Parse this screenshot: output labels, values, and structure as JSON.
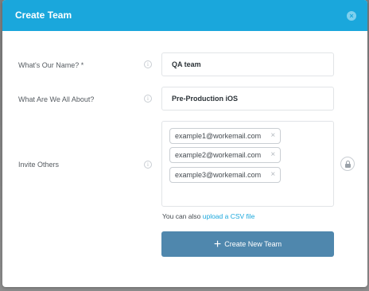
{
  "modal": {
    "title": "Create Team",
    "close_icon": "×"
  },
  "form": {
    "name_label": "What's Our Name? *",
    "name_value": "QA team",
    "about_label": "What Are We All About?",
    "about_value": "Pre-Production iOS",
    "invite_label": "Invite Others",
    "info_icon": "i",
    "invites": [
      "example1@workemail.com",
      "example2@workemail.com",
      "example3@workemail.com"
    ],
    "remove_icon": "×",
    "csv_prefix": "You can also ",
    "csv_link": "upload a CSV file",
    "submit_icon": "+",
    "submit_label": "Create New Team"
  }
}
